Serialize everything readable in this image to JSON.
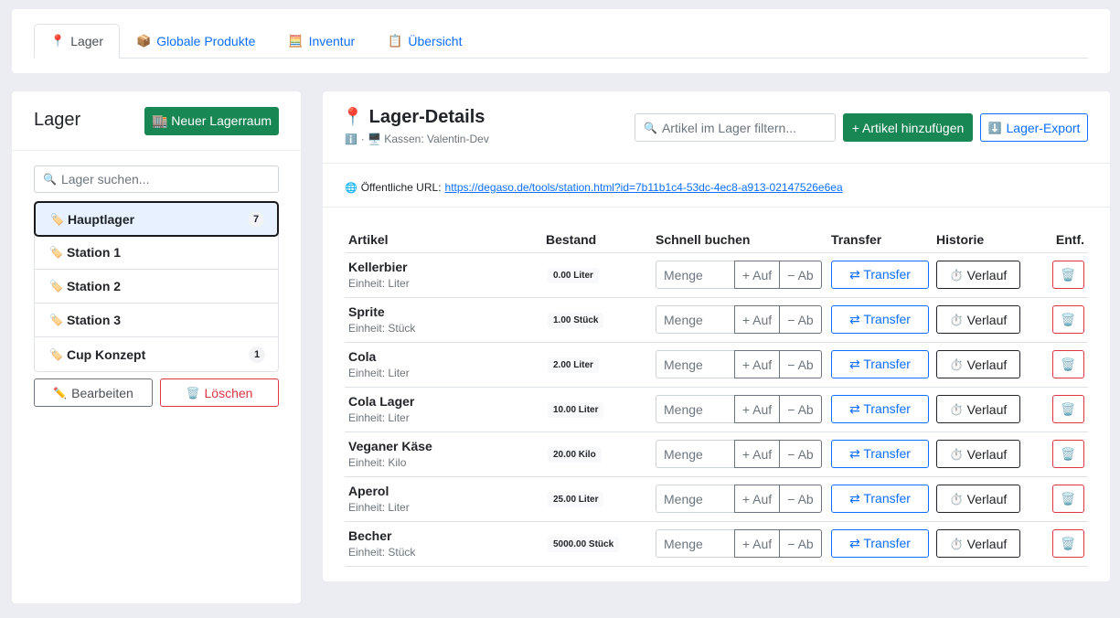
{
  "tabs": [
    {
      "icon": "📍",
      "label": "Lager"
    },
    {
      "icon": "📦",
      "label": "Globale Produkte"
    },
    {
      "icon": "🧮",
      "label": "Inventur"
    },
    {
      "icon": "📋",
      "label": "Übersicht"
    }
  ],
  "sidebar": {
    "title": "Lager",
    "new_button": "🏬 Neuer Lagerraum",
    "search_placeholder": "Lager suchen...",
    "items": [
      {
        "label": "Hauptlager",
        "count": "7"
      },
      {
        "label": "Station 1",
        "count": ""
      },
      {
        "label": "Station 2",
        "count": ""
      },
      {
        "label": "Station 3",
        "count": ""
      },
      {
        "label": "Cup Konzept",
        "count": "1"
      }
    ],
    "edit_label": "Bearbeiten",
    "delete_label": "Löschen"
  },
  "details": {
    "title": "Lager-Details",
    "subtitle": "· 🖥️ Kassen: Valentin-Dev",
    "filter_placeholder": "Artikel im Lager filtern...",
    "add_button": "+ Artikel hinzufügen",
    "export_button": "Lager-Export",
    "url_label": "Öffentliche URL:",
    "url": "https://degaso.de/tools/station.html?id=7b11b1c4-53dc-4ec8-a913-02147526e6ea"
  },
  "table": {
    "headers": [
      "Artikel",
      "Bestand",
      "Schnell buchen",
      "Transfer",
      "Historie",
      "Entf."
    ],
    "menge_placeholder": "Menge",
    "auf_label": "+ Auf",
    "ab_label": "− Ab",
    "transfer_label": "⇄ Transfer",
    "verlauf_label": "Verlauf",
    "rows": [
      {
        "name": "Kellerbier",
        "unit": "Einheit: Liter",
        "bestand": "0.00 Liter"
      },
      {
        "name": "Sprite",
        "unit": "Einheit: Stück",
        "bestand": "1.00 Stück"
      },
      {
        "name": "Cola",
        "unit": "Einheit: Liter",
        "bestand": "2.00 Liter"
      },
      {
        "name": "Cola Lager",
        "unit": "Einheit: Liter",
        "bestand": "10.00 Liter"
      },
      {
        "name": "Veganer Käse",
        "unit": "Einheit: Kilo",
        "bestand": "20.00 Kilo"
      },
      {
        "name": "Aperol",
        "unit": "Einheit: Liter",
        "bestand": "25.00 Liter"
      },
      {
        "name": "Becher",
        "unit": "Einheit: Stück",
        "bestand": "5000.00 Stück"
      }
    ]
  }
}
